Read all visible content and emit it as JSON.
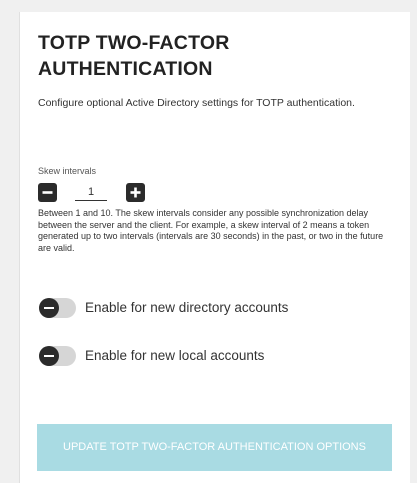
{
  "panel": {
    "title": "TOTP TWO-FACTOR AUTHENTICATION",
    "description": "Configure optional Active Directory settings for TOTP authentication."
  },
  "skew": {
    "label": "Skew intervals",
    "value": "1",
    "help": "Between 1 and 10. The skew intervals consider any possible synchronization delay between the server and the client. For example, a skew interval of 2 means a token generated up to two intervals (intervals are 30 seconds) in the past, or two in the future are valid.",
    "decrement_icon": "minus-icon",
    "increment_icon": "plus-icon"
  },
  "toggles": {
    "directory": {
      "label": "Enable for new directory accounts",
      "enabled": false
    },
    "local": {
      "label": "Enable for new local accounts",
      "enabled": false
    }
  },
  "actions": {
    "update_label": "UPDATE TOTP TWO-FACTOR AUTHENTICATION OPTIONS"
  },
  "colors": {
    "dark": "#2b2b2b",
    "toggle_track": "#d6d6d6",
    "update_button": "#a9dbe3"
  }
}
